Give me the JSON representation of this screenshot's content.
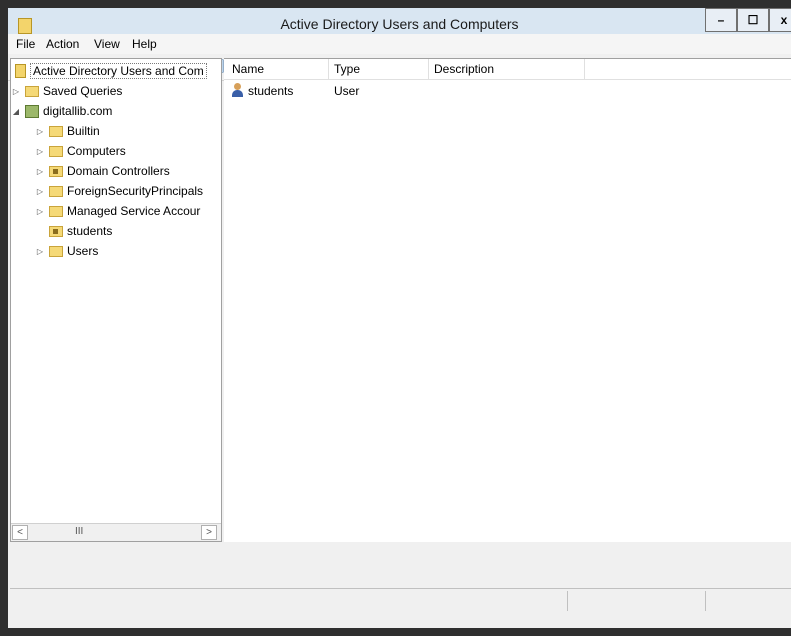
{
  "window": {
    "title": "Active Directory Users and Computers"
  },
  "titlebar_buttons": {
    "minimize": "–",
    "maximize": "☐",
    "close": "x"
  },
  "menu": [
    "File",
    "Action",
    "View",
    "Help"
  ],
  "toolbar_icons": [
    "back-arrow-icon",
    "forward-arrow-icon",
    "up-folder-icon",
    "show-console-tree-icon",
    "properties-icon",
    "export-list-icon",
    "refresh-icon",
    "export-icon",
    "help-icon",
    "show-action-pane-icon",
    "new-user-icon",
    "new-group-icon",
    "new-ou-icon",
    "filter-icon",
    "add-to-group-icon",
    "delegate-icon"
  ],
  "tree": {
    "root": "Active Directory Users and Com",
    "saved_queries": "Saved Queries",
    "domain": "digitallib.com",
    "children": [
      "Builtin",
      "Computers",
      "Domain Controllers",
      "ForeignSecurityPrincipals",
      "Managed Service Accour",
      "students",
      "Users"
    ]
  },
  "list": {
    "columns": [
      "Name",
      "Type",
      "Description"
    ],
    "rows": [
      {
        "name": "students",
        "type": "User",
        "description": ""
      }
    ]
  },
  "scrollbar": {
    "left": "<",
    "right": ">",
    "thumb": "III"
  }
}
